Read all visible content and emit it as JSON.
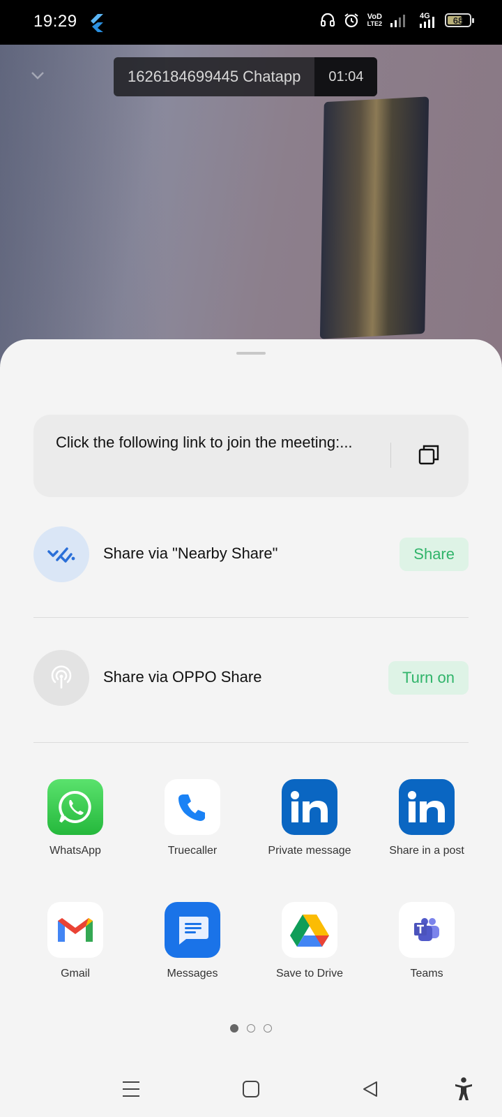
{
  "status_bar": {
    "time": "19:29",
    "network_top": "VoD",
    "network_bottom": "LTE2",
    "network_type": "4G",
    "battery_level": "68",
    "battery_fraction": 0.68,
    "icons": [
      "flutter-icon",
      "headset-icon",
      "alarm-icon",
      "signal-icon",
      "battery-icon"
    ]
  },
  "call": {
    "title": "1626184699445 Chatapp",
    "timer": "01:04"
  },
  "share_sheet": {
    "link_text": "Click the following link to join the meeting:...",
    "nearby": {
      "label": "Share via \"Nearby Share\"",
      "action": "Share"
    },
    "oppo": {
      "label": "Share via OPPO Share",
      "action": "Turn on"
    },
    "apps": [
      {
        "name": "WhatsApp",
        "icon": "whatsapp-icon"
      },
      {
        "name": "Truecaller",
        "icon": "truecaller-icon"
      },
      {
        "name": "Private message",
        "icon": "linkedin-icon"
      },
      {
        "name": "Share in a post",
        "icon": "linkedin-icon"
      },
      {
        "name": "Gmail",
        "icon": "gmail-icon"
      },
      {
        "name": "Messages",
        "icon": "messages-icon"
      },
      {
        "name": "Save to Drive",
        "icon": "drive-icon"
      },
      {
        "name": "Teams",
        "icon": "teams-icon"
      }
    ],
    "pages": {
      "total": 3,
      "current": 1
    }
  },
  "colors": {
    "accent_green": "#30b46a",
    "nearby_blue": "#2a6fd8",
    "whatsapp": "#25d366",
    "linkedin": "#0a66c2",
    "messages": "#1a73e8"
  }
}
